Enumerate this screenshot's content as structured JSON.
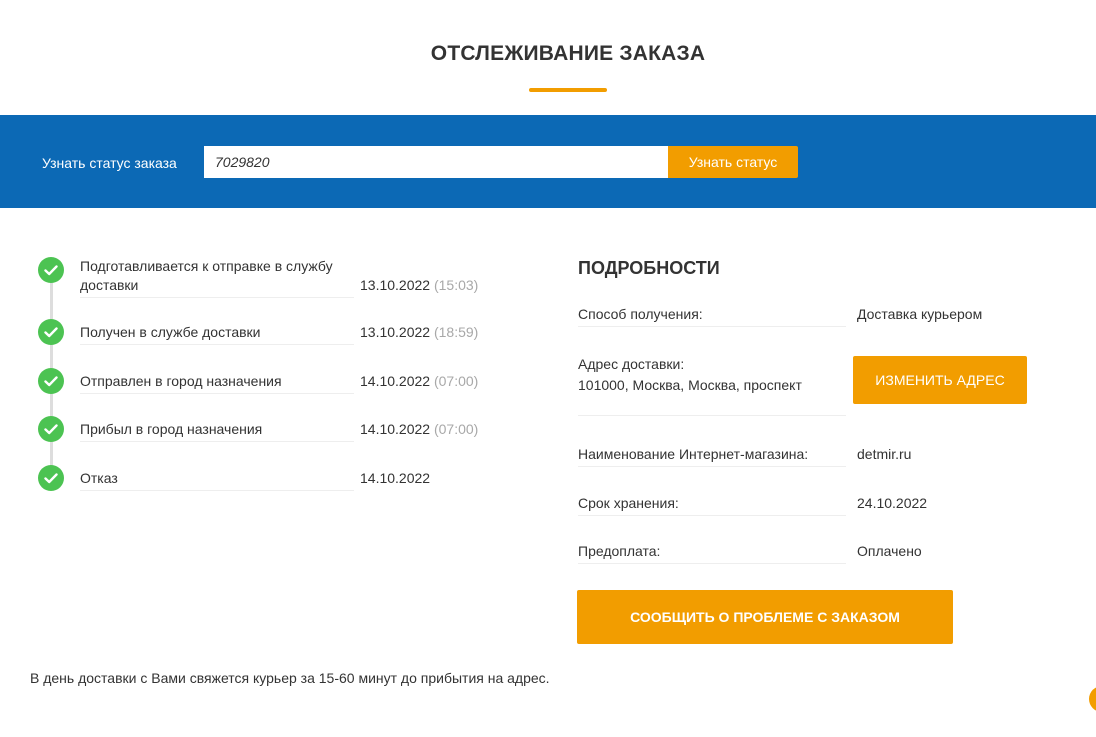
{
  "page": {
    "title": "ОТСЛЕЖИВАНИЕ ЗАКАЗА"
  },
  "search": {
    "label": "Узнать статус заказа",
    "value": "7029820",
    "button_label": "Узнать статус"
  },
  "timeline": [
    {
      "label": "Подготавливается к отправке в службу доставки",
      "date": "13.10.2022",
      "time": "(15:03)",
      "status_icon": "check-icon"
    },
    {
      "label": "Получен в службе доставки",
      "date": "13.10.2022",
      "time": "(18:59)",
      "status_icon": "check-icon"
    },
    {
      "label": "Отправлен в город назначения",
      "date": "14.10.2022",
      "time": "(07:00)",
      "status_icon": "check-icon"
    },
    {
      "label": "Прибыл в город назначения",
      "date": "14.10.2022",
      "time": "(07:00)",
      "status_icon": "check-icon"
    },
    {
      "label": "Отказ",
      "date": "14.10.2022",
      "time": "",
      "status_icon": "check-icon"
    }
  ],
  "details": {
    "heading": "ПОДРОБНОСТИ",
    "delivery_method_label": "Способ получения:",
    "delivery_method_value": "Доставка курьером",
    "address_label": "Адрес доставки:",
    "address_value": "101000, Москва, Москва, проспект",
    "change_address_label": "ИЗМЕНИТЬ АДРЕС",
    "shop_label": "Наименование Интернет-магазина:",
    "shop_value": "detmir.ru",
    "storage_label": "Срок хранения:",
    "storage_value": "24.10.2022",
    "prepayment_label": "Предоплата:",
    "prepayment_value": "Оплачено",
    "report_label": "СООБЩИТЬ О ПРОБЛЕМЕ С ЗАКАЗОМ"
  },
  "footer": {
    "note": "В день доставки с Вами свяжется курьер за 15-60 минут до прибытия на адрес."
  },
  "colors": {
    "accent": "#f29d00",
    "band": "#0c69b5",
    "success": "#4cc352",
    "muted": "#a8a8a8"
  }
}
